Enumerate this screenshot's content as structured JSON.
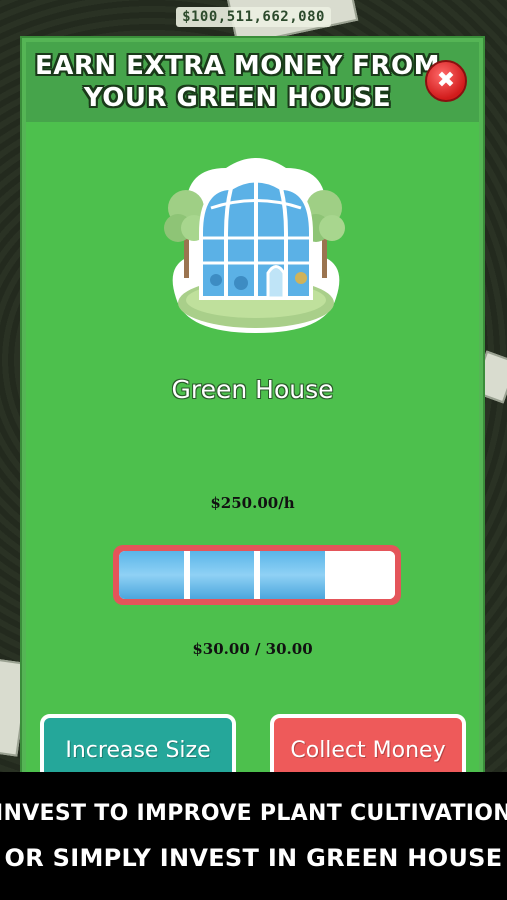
{
  "header": {
    "balance": "$100,511,662,080"
  },
  "modal": {
    "title_line1": "EARN EXTRA MONEY FROM",
    "title_line2": "YOUR GREEN HOUSE",
    "building_name": "Green House",
    "rate": "$250.00/h",
    "progress": {
      "filled_segments": 3,
      "total_segments": 4,
      "text": "$30.00 / 30.00"
    },
    "buttons": {
      "increase": "Increase Size",
      "collect": "Collect Money"
    }
  },
  "caption": {
    "line1": "INVEST TO IMPROVE PLANT CULTIVATION",
    "line2": "OR SIMPLY INVEST IN GREEN HOUSE"
  },
  "icons": {
    "close": "close-icon",
    "illustration": "greenhouse-icon"
  },
  "colors": {
    "panel": "#4dc04d",
    "increase_button": "#25a79a",
    "collect_button": "#ee5a5a",
    "progress_fill": "#5ab5e8"
  }
}
